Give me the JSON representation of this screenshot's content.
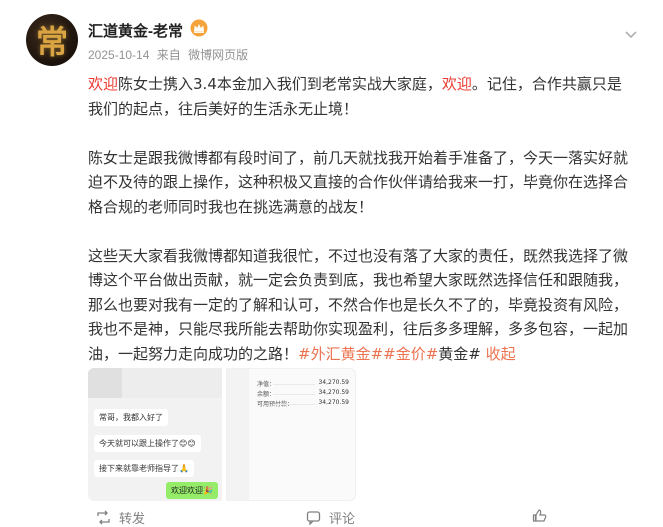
{
  "author": {
    "avatar_char": "常",
    "name": "汇道黄金-老常",
    "badge_icon": "vip-crown-icon"
  },
  "meta": {
    "date": "2025-10-14",
    "source_prefix": "来自",
    "source": "微博网页版"
  },
  "post": {
    "p1": {
      "welcome1": "欢迎",
      "text1": "陈女士携入3.4本金加入我们到老常实战大家庭，",
      "welcome2": "欢迎",
      "text2": "。记住，合作共赢只是我们的起点，往后美好的生活永无止境！"
    },
    "p2": "陈女士是跟我微博都有段时间了，前几天就找我开始着手准备了，今天一落实好就迫不及待的跟上操作，这种积极又直接的合作伙伴请给我来一打，毕竟你在选择合格合规的老师同时我也在挑选满意的战友！",
    "p3": {
      "text": "这些天大家看我微博都知道我很忙，不过也没有落了大家的责任，既然我选择了微博这个平台做出贡献，就一定会负责到底，我也希望大家既然选择信任和跟随我，那么也要对我有一定的了解和认可，不然合作也是长久不了的，毕竟投资有风险，我也不是神，只能尽我所能去帮助你实现盈利，往后多多理解，多多包容，一起加油，一起努力走向成功的之路！",
      "tag1": "#外汇黄金#",
      "tag2": "#金价#",
      "plain": "黄金#",
      "collapse": "收起"
    }
  },
  "image1": {
    "msg1": "常哥，我都入好了",
    "msg2": "今天就可以跟上操作了😊😊",
    "msg3": "接下来就靠老师指导了🙏",
    "reply": "欢迎欢迎🎉"
  },
  "image2": {
    "rows": [
      {
        "k": "净值：",
        "v": "34,270.59"
      },
      {
        "k": "余额：",
        "v": "34,270.59"
      },
      {
        "k": "可用预付款：",
        "v": "34,270.59"
      }
    ]
  },
  "actions": {
    "repost": "转发",
    "comment": "评论",
    "like": ""
  }
}
